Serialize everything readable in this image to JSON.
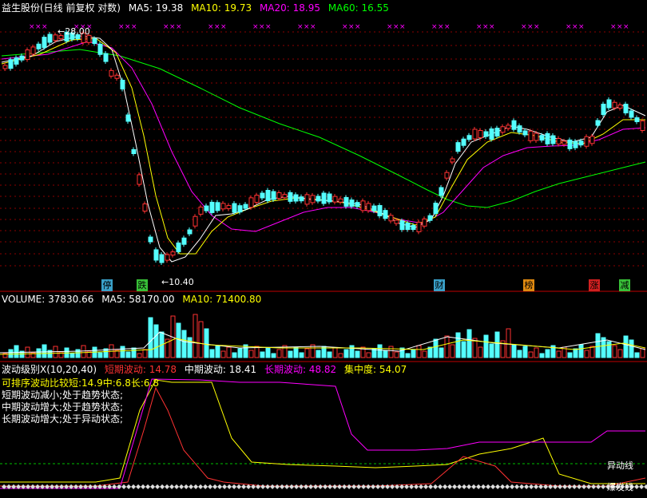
{
  "main_legend": {
    "title": "益生股份(日线 前复权 对数)",
    "ma5": "MA5: 19.38",
    "ma10": "MA10: 19.73",
    "ma20": "MA20: 18.95",
    "ma60": "MA60: 16.55"
  },
  "colors": {
    "up": "#ff3232",
    "down": "#54ffff",
    "ma5": "#ffffff",
    "ma10": "#ffff00",
    "ma20": "#ff00ff",
    "ma60": "#00ff00",
    "grid": "#8b0000",
    "tag_blue": "#3aa0c8",
    "tag_green": "#38c038",
    "tag_orange": "#e08a10",
    "tag_red": "#d02020"
  },
  "price_high": "28.00",
  "price_low": "10.40",
  "event_tags": [
    {
      "label": "停",
      "style": "blue"
    },
    {
      "label": "跌",
      "style": "green"
    },
    {
      "label": "财",
      "style": "blue"
    },
    {
      "label": "榜",
      "style": "orange"
    },
    {
      "label": "涨",
      "style": "red"
    },
    {
      "label": "减",
      "style": "green"
    }
  ],
  "volume_legend": {
    "volume": "VOLUME: 37830.66",
    "ma5": "MA5: 58170.00",
    "ma10": "MA10: 71400.80"
  },
  "wave_legend": {
    "title": "波动级别X(10,20,40)",
    "short": "短期波动: 14.78",
    "mid": "中期波动: 18.41",
    "long": "长期波动: 48.82",
    "concentration": "集中度: 54.07"
  },
  "wave_stats": {
    "sortable": "可排序波动比较短:14.9中:6.8长:6.8",
    "line1": "短期波动减小;处于趋势状态;",
    "line2": "中期波动增大;处于趋势状态;",
    "line3": "长期波动增大;处于异动状态;"
  },
  "anomaly_line_label": "异动线",
  "burst_label": "爆发线",
  "chart_data": {
    "type": "candlestick",
    "title": "益生股份(日线 前复权 对数)",
    "ma_values": {
      "MA5": 19.38,
      "MA10": 19.73,
      "MA20": 18.95,
      "MA60": 16.55
    },
    "price_high": 28.0,
    "price_low": 10.4,
    "volume": 37830.66,
    "volume_ma5": 58170.0,
    "volume_ma10": 71400.8,
    "wave_short": 14.78,
    "wave_mid": 18.41,
    "wave_long": 48.82,
    "concentration": 54.07
  }
}
